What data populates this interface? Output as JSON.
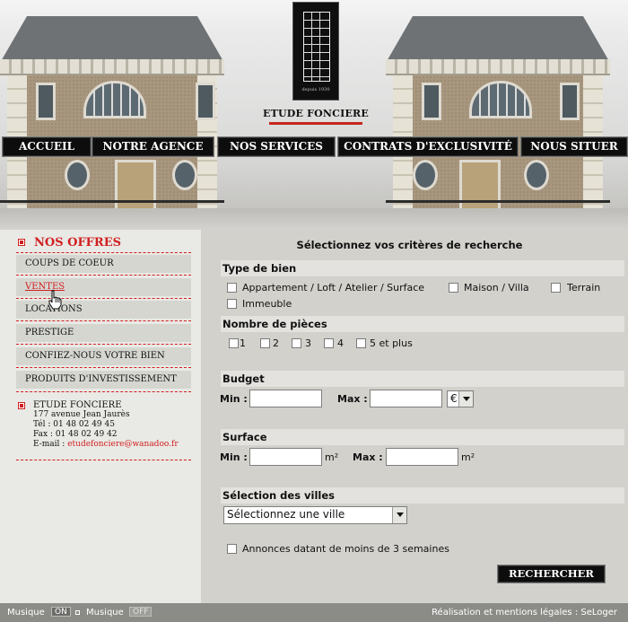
{
  "brand": {
    "name": "ETUDE FONCIERE",
    "logo_tagline": "depuis 1930"
  },
  "nav": [
    "ACCUEIL",
    "NOTRE AGENCE",
    "NOS SERVICES",
    "CONTRATS D'EXCLUSIVITÉ",
    "NOUS SITUER"
  ],
  "sidebar": {
    "title": "NOS OFFRES",
    "items": [
      "COUPS DE COEUR",
      "VENTES",
      "LOCATIONS",
      "PRESTIGE",
      "CONFIEZ-NOUS VOTRE BIEN",
      "PRODUITS D'INVESTISSEMENT"
    ],
    "active_item": "VENTES",
    "contact": {
      "name": "ETUDE FONCIERE",
      "address": "177 avenue Jean Jaurès",
      "tel": "Tél : 01 48 02 49 45",
      "fax": "Fax : 01 48 02 49 42",
      "email_label": "E-mail : ",
      "email": "etudefonciere@wanadoo.fr"
    }
  },
  "search": {
    "title": "Sélectionnez vos critères de recherche",
    "type_bien": {
      "label": "Type de bien",
      "options": [
        "Appartement / Loft / Atelier / Surface",
        "Maison / Villa",
        "Terrain",
        "Immeuble"
      ]
    },
    "pieces": {
      "label": "Nombre de pièces",
      "options": [
        "1",
        "2",
        "3",
        "4",
        "5 et plus"
      ]
    },
    "budget": {
      "label": "Budget",
      "min_label": "Min :",
      "max_label": "Max :",
      "min_value": "",
      "max_value": "",
      "currency": "€"
    },
    "surface": {
      "label": "Surface",
      "min_label": "Min :",
      "max_label": "Max :",
      "min_value": "",
      "max_value": "",
      "unit": "m²"
    },
    "villes": {
      "label": "Sélection des villes",
      "selected": "Sélectionnez une ville"
    },
    "recent": "Annonces datant de moins de 3 semaines",
    "button": "RECHERCHER"
  },
  "footer": {
    "musique_label": "Musique",
    "on": "ON",
    "off": "OFF",
    "credits": "Réalisation et mentions légales : SeLoger"
  },
  "colors": {
    "accent": "#d02020",
    "nav_bg": "#0d0d0d",
    "panel": "#d2d1cc",
    "sidebar": "#e9e9e5",
    "footer": "#8b8b87"
  }
}
